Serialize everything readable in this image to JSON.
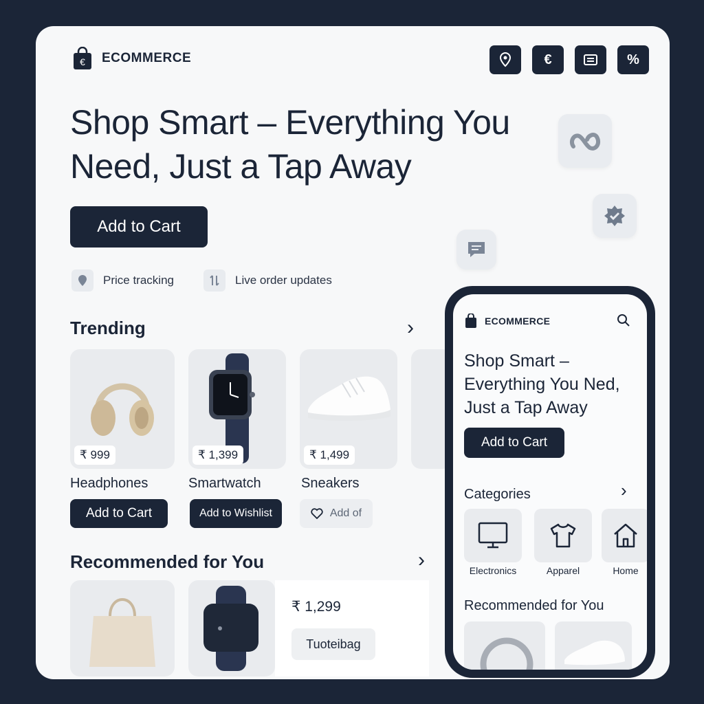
{
  "brand": {
    "name": "ECOMMERCE"
  },
  "header_icons": [
    "location-icon",
    "euro-icon",
    "receipt-icon",
    "percent-icon"
  ],
  "hero": {
    "title": "Shop Smart – Everything You Need, Just a Tap Away",
    "cta": "Add to Cart"
  },
  "features": [
    {
      "label": "Price tracking",
      "icon": "location-icon"
    },
    {
      "label": "Live order updates",
      "icon": "transfer-icon"
    }
  ],
  "trending": {
    "title": "Trending",
    "chevron": "›",
    "items": [
      {
        "name": "Headphones",
        "price": "₹ 999",
        "action": "Add to Cart"
      },
      {
        "name": "Smartwatch",
        "price": "₹ 1,399",
        "action": "Add to Wishlist"
      },
      {
        "name": "Sneakers",
        "price": "₹ 1,499",
        "action": "Add of"
      }
    ]
  },
  "recommended": {
    "title": "Recommended for You",
    "chevron": "›",
    "price": "₹ 1,299",
    "tag": "Tuoteibag"
  },
  "phone": {
    "brand": "ECOMMERCE",
    "hero_title": "Shop Smart – Everything You Ned, Just a Tap Away",
    "cta": "Add to Cart",
    "categories_title": "Categories",
    "chevron": "›",
    "categories": [
      {
        "label": "Electronics",
        "icon": "monitor-icon"
      },
      {
        "label": "Apparel",
        "icon": "tshirt-icon"
      },
      {
        "label": "Home",
        "icon": "home-icon"
      }
    ],
    "recommended_title": "Recommended for You"
  },
  "colors": {
    "dark": "#1b2537",
    "card": "#f7f8f9",
    "tile": "#e9ebee"
  }
}
